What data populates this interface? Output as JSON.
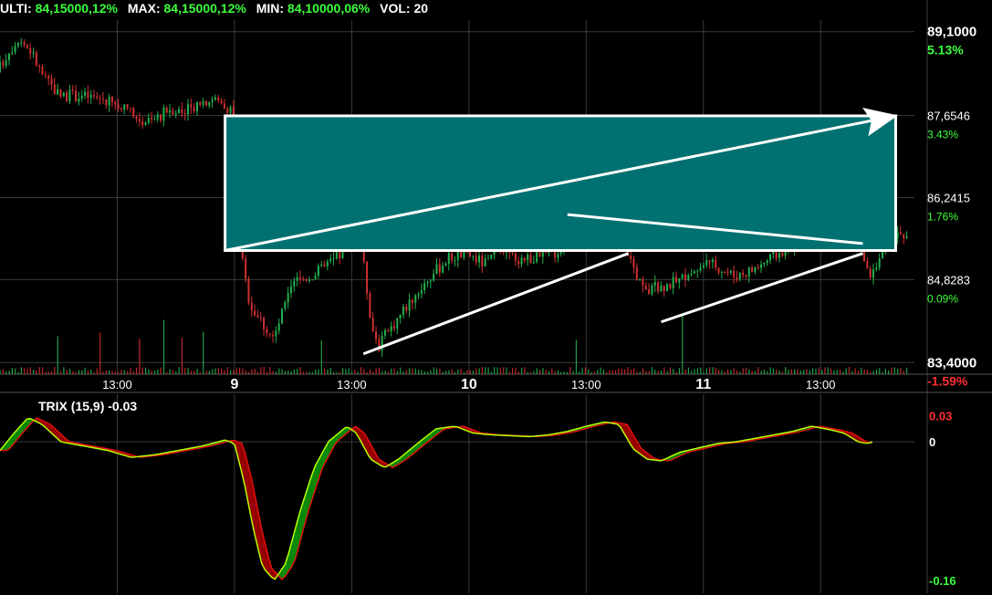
{
  "header": {
    "last_label": "ULTI:",
    "last_value": "84,15000,12%",
    "max_label": "MAX:",
    "max_value": "84,15000,12%",
    "min_label": "MIN:",
    "min_value": "84,10000,06%",
    "vol_label": "VOL:",
    "vol_value": "20"
  },
  "trix_header": "TRIX (15,9) -0.03",
  "colors": {
    "background": "#000000",
    "grid": "#3a3a3a",
    "candle_up": "#22b14c",
    "candle_down": "#d03030",
    "box_fill": "#007070",
    "box_stroke": "#ffffff",
    "trend_line": "#ffffff",
    "pct_up": "#3dff3d",
    "pct_down": "#ff3030",
    "trix_line": "#b8ff00",
    "trix_signal": "#e01010",
    "trix_fill_up": "#0a8a0a",
    "trix_fill_down": "#9a0000"
  },
  "chart_data": [
    {
      "type": "candlestick",
      "title": "",
      "price_axis": [
        {
          "label": "89,1000",
          "value": 89.1,
          "pct": "5.13%",
          "pct_color": "#3dff3d"
        },
        {
          "label": "87,6546",
          "value": 87.6546,
          "pct": "3.43%",
          "pct_color": "#3dff3d"
        },
        {
          "label": "86,2415",
          "value": 86.2415,
          "pct": "1.76%",
          "pct_color": "#3dff3d"
        },
        {
          "label": "84,8283",
          "value": 84.8283,
          "pct": "0.09%",
          "pct_color": "#3dff3d"
        },
        {
          "label": "83,4000",
          "value": 83.4,
          "pct": "-1.59%",
          "pct_color": "#ff3030"
        }
      ],
      "ylim": [
        83.2,
        89.3
      ],
      "time_axis": [
        {
          "label": "13:00",
          "x": 0.5,
          "bold": false
        },
        {
          "label": "9",
          "x": 1.0,
          "bold": true
        },
        {
          "label": "13:00",
          "x": 1.5,
          "bold": false
        },
        {
          "label": "10",
          "x": 2.0,
          "bold": true
        },
        {
          "label": "13:00",
          "x": 2.5,
          "bold": false
        },
        {
          "label": "11",
          "x": 3.0,
          "bold": true
        },
        {
          "label": "13:00",
          "x": 3.5,
          "bold": false
        }
      ],
      "xlim": [
        0,
        3.9
      ],
      "price_path": [
        [
          0.0,
          88.4
        ],
        [
          0.04,
          88.7
        ],
        [
          0.09,
          89.0
        ],
        [
          0.14,
          88.8
        ],
        [
          0.2,
          88.3
        ],
        [
          0.27,
          88.0
        ],
        [
          0.35,
          88.0
        ],
        [
          0.45,
          87.95
        ],
        [
          0.52,
          87.8
        ],
        [
          0.6,
          87.6
        ],
        [
          0.66,
          87.55
        ],
        [
          0.74,
          87.8
        ],
        [
          0.8,
          87.7
        ],
        [
          0.86,
          87.9
        ],
        [
          0.92,
          87.95
        ],
        [
          0.97,
          87.85
        ],
        [
          1.0,
          87.75
        ],
        [
          1.02,
          86.5
        ],
        [
          1.05,
          85.0
        ],
        [
          1.08,
          84.4
        ],
        [
          1.13,
          84.1
        ],
        [
          1.18,
          83.8
        ],
        [
          1.22,
          84.3
        ],
        [
          1.27,
          84.8
        ],
        [
          1.34,
          84.9
        ],
        [
          1.42,
          85.1
        ],
        [
          1.5,
          85.4
        ],
        [
          1.55,
          85.5
        ],
        [
          1.6,
          84.0
        ],
        [
          1.63,
          83.7
        ],
        [
          1.68,
          84.0
        ],
        [
          1.75,
          84.4
        ],
        [
          1.83,
          84.8
        ],
        [
          1.92,
          85.2
        ],
        [
          2.0,
          85.3
        ],
        [
          2.08,
          85.1
        ],
        [
          2.15,
          85.3
        ],
        [
          2.22,
          85.2
        ],
        [
          2.3,
          85.2
        ],
        [
          2.38,
          85.3
        ],
        [
          2.45,
          85.6
        ],
        [
          2.52,
          86.0
        ],
        [
          2.58,
          86.2
        ],
        [
          2.64,
          85.9
        ],
        [
          2.7,
          85.2
        ],
        [
          2.76,
          84.6
        ],
        [
          2.82,
          84.7
        ],
        [
          2.9,
          84.8
        ],
        [
          2.98,
          85.0
        ],
        [
          3.06,
          85.1
        ],
        [
          3.14,
          84.9
        ],
        [
          3.22,
          85.0
        ],
        [
          3.3,
          85.2
        ],
        [
          3.38,
          85.4
        ],
        [
          3.46,
          85.6
        ],
        [
          3.54,
          85.8
        ],
        [
          3.62,
          85.9
        ],
        [
          3.68,
          85.5
        ],
        [
          3.72,
          84.9
        ],
        [
          3.76,
          85.1
        ],
        [
          3.8,
          85.6
        ]
      ],
      "volume_seed": 17
    },
    {
      "type": "line",
      "title": "TRIX (15,9)",
      "last_value": -0.03,
      "ylim": [
        -0.175,
        0.055
      ],
      "axis_labels": [
        {
          "label": "0.03",
          "value": 0.03,
          "color": "#ff3030"
        },
        {
          "label": "0",
          "value": 0.0,
          "color": "#ffffff"
        },
        {
          "label": "-0.16",
          "value": -0.16,
          "color": "#3dff3d"
        }
      ],
      "trix_path": [
        [
          0.0,
          -0.01
        ],
        [
          0.06,
          0.01
        ],
        [
          0.12,
          0.028
        ],
        [
          0.18,
          0.02
        ],
        [
          0.26,
          0.0
        ],
        [
          0.36,
          -0.005
        ],
        [
          0.46,
          -0.01
        ],
        [
          0.56,
          -0.018
        ],
        [
          0.66,
          -0.015
        ],
        [
          0.76,
          -0.01
        ],
        [
          0.86,
          -0.005
        ],
        [
          0.96,
          0.002
        ],
        [
          1.0,
          -0.002
        ],
        [
          1.04,
          -0.045
        ],
        [
          1.08,
          -0.1
        ],
        [
          1.12,
          -0.145
        ],
        [
          1.17,
          -0.16
        ],
        [
          1.22,
          -0.14
        ],
        [
          1.28,
          -0.08
        ],
        [
          1.34,
          -0.03
        ],
        [
          1.4,
          0.0
        ],
        [
          1.48,
          0.018
        ],
        [
          1.52,
          0.01
        ],
        [
          1.58,
          -0.02
        ],
        [
          1.64,
          -0.03
        ],
        [
          1.7,
          -0.02
        ],
        [
          1.78,
          -0.002
        ],
        [
          1.86,
          0.015
        ],
        [
          1.94,
          0.018
        ],
        [
          2.02,
          0.01
        ],
        [
          2.1,
          0.008
        ],
        [
          2.18,
          0.007
        ],
        [
          2.26,
          0.006
        ],
        [
          2.34,
          0.008
        ],
        [
          2.42,
          0.012
        ],
        [
          2.5,
          0.018
        ],
        [
          2.58,
          0.023
        ],
        [
          2.64,
          0.02
        ],
        [
          2.7,
          -0.008
        ],
        [
          2.76,
          -0.02
        ],
        [
          2.82,
          -0.022
        ],
        [
          2.9,
          -0.012
        ],
        [
          2.98,
          -0.007
        ],
        [
          3.06,
          -0.002
        ],
        [
          3.14,
          0.0
        ],
        [
          3.22,
          0.004
        ],
        [
          3.3,
          0.008
        ],
        [
          3.38,
          0.012
        ],
        [
          3.46,
          0.018
        ],
        [
          3.54,
          0.014
        ],
        [
          3.6,
          0.01
        ],
        [
          3.66,
          0.0
        ],
        [
          3.7,
          -0.002
        ],
        [
          3.72,
          0.0
        ]
      ],
      "signal_lag": 0.035
    }
  ],
  "annotations": {
    "box": {
      "label": "rectangle",
      "x0": 0.96,
      "x1": 3.82,
      "y0": 87.65,
      "y1": 85.33
    },
    "lines": [
      {
        "x0": 0.96,
        "y0": 85.33,
        "x1": 3.82,
        "y1": 87.65,
        "arrow": true
      },
      {
        "x0": 1.55,
        "y0": 83.55,
        "x1": 2.68,
        "y1": 85.28,
        "arrow": false
      },
      {
        "x0": 2.42,
        "y0": 85.95,
        "x1": 3.68,
        "y1": 85.45,
        "arrow": false
      },
      {
        "x0": 2.82,
        "y0": 84.1,
        "x1": 3.68,
        "y1": 85.28,
        "arrow": false
      }
    ]
  }
}
